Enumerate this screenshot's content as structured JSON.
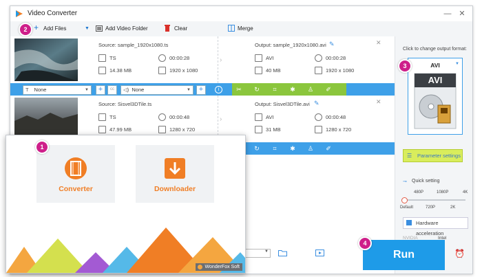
{
  "window": {
    "title": "Video Converter",
    "minimize": "—",
    "close": "✕"
  },
  "toolbar": {
    "add_files": "Add Files",
    "add_video_folder": "Add Video Folder",
    "clear": "Clear",
    "merge": "Merge"
  },
  "badges": {
    "b1": "1",
    "b2": "2",
    "b3": "3",
    "b4": "4"
  },
  "files": [
    {
      "source": "Source: sample_1920x1080.ts",
      "src_format": "TS",
      "src_duration": "00:00:28",
      "src_size": "14.38 MB",
      "src_resolution": "1920 x 1080",
      "output": "Output: sample_1920x1080.avi",
      "out_format": "AVI",
      "out_duration": "00:00:28",
      "out_size": "40 MB",
      "out_resolution": "1920 x 1080"
    },
    {
      "source": "Source: Sisvel3DTile.ts",
      "src_format": "TS",
      "src_duration": "00:00:48",
      "src_size": "47.99 MB",
      "src_resolution": "1280 x 720",
      "output": "Output: Sisvel3DTile.avi",
      "out_format": "AVI",
      "out_duration": "00:00:48",
      "out_size": "31 MB",
      "out_resolution": "1280 x 720"
    }
  ],
  "options": {
    "subtitle": "None",
    "audio": "None"
  },
  "side": {
    "click_label": "Click to change output format:",
    "format": "AVI",
    "format_icon_text": "AVI",
    "param_settings": "Parameter settings",
    "quick_setting": "Quick setting",
    "quality_top": [
      "480P",
      "1080P",
      "4K"
    ],
    "quality_bottom": [
      "Default",
      "720P",
      "2K"
    ],
    "hw_accel": "Hardware acceleration",
    "nvidia": "NVIDIA",
    "intel": "Intel"
  },
  "run": "Run",
  "popup": {
    "converter": "Converter",
    "downloader": "Downloader",
    "brand": "WonderFox Soft"
  },
  "colors": {
    "accent": "#1e9be8",
    "badge": "#ce1f8a",
    "orange": "#f07e25",
    "green": "#8bc63d"
  }
}
